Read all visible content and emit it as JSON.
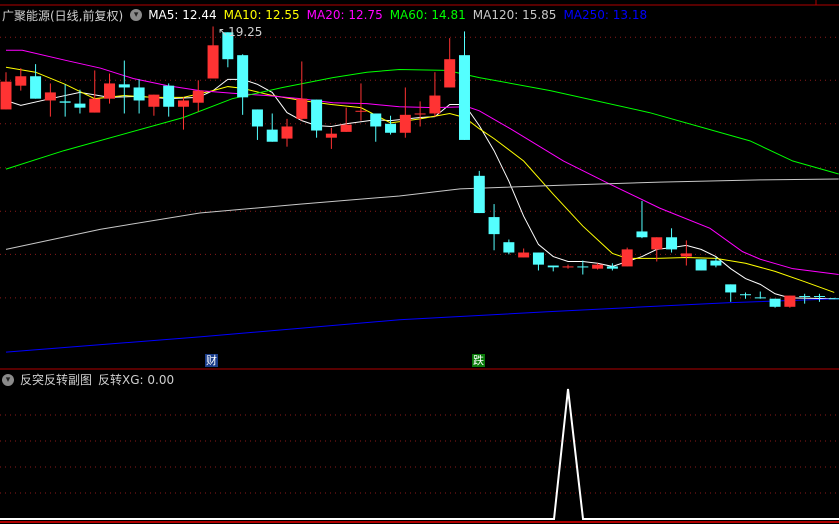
{
  "header": {
    "stock_name": "广聚能源(日线,前复权)",
    "ma": [
      {
        "label": "MA5: 12.44",
        "color": "#ffffff"
      },
      {
        "label": "MA10: 12.55",
        "color": "#ffff00"
      },
      {
        "label": "MA20: 12.75",
        "color": "#ff00ff"
      },
      {
        "label": "MA60: 14.81",
        "color": "#00ff00"
      },
      {
        "label": "MA120: 15.85",
        "color": "#c8c8c8"
      },
      {
        "label": "MA250: 13.18",
        "color": "#0000ff"
      }
    ],
    "high_marker": "19.25"
  },
  "markers": {
    "cai": "财",
    "die": "跌"
  },
  "sub_panel": {
    "title": "反突反转副图",
    "indicator": "反转XG: 0.00"
  },
  "colors": {
    "up": "#ff3333",
    "down": "#54ffff",
    "grid": "#8b1a1a",
    "border": "#b00000"
  },
  "chart_data": {
    "type": "candlestick",
    "candles": [
      [
        17.4,
        18.23,
        17.4,
        18.02
      ],
      [
        17.93,
        18.32,
        17.82,
        18.14
      ],
      [
        18.14,
        18.41,
        17.64,
        17.64
      ],
      [
        17.6,
        17.98,
        17.24,
        17.78
      ],
      [
        17.58,
        17.96,
        17.24,
        17.55
      ],
      [
        17.53,
        17.84,
        17.31,
        17.44
      ],
      [
        17.33,
        18.27,
        17.33,
        17.64
      ],
      [
        17.64,
        18.2,
        17.53,
        17.98
      ],
      [
        17.96,
        18.49,
        17.31,
        17.89
      ],
      [
        17.89,
        18.07,
        17.31,
        17.6
      ],
      [
        17.46,
        17.73,
        17.26,
        17.73
      ],
      [
        17.93,
        17.98,
        17.24,
        17.46
      ],
      [
        17.46,
        17.67,
        16.95,
        17.6
      ],
      [
        17.55,
        18.05,
        17.35,
        17.82
      ],
      [
        18.09,
        19.25,
        18.09,
        18.83
      ],
      [
        19.12,
        19.12,
        18.34,
        18.52
      ],
      [
        18.61,
        18.63,
        17.28,
        17.67
      ],
      [
        17.4,
        17.4,
        16.72,
        17.02
      ],
      [
        16.95,
        17.31,
        16.68,
        16.68
      ],
      [
        16.75,
        17.19,
        16.57,
        17.02
      ],
      [
        17.19,
        18.47,
        17.15,
        17.64
      ],
      [
        17.62,
        17.62,
        16.77,
        16.93
      ],
      [
        16.77,
        16.99,
        16.52,
        16.86
      ],
      [
        16.9,
        17.44,
        16.9,
        17.06
      ],
      [
        17.36,
        17.98,
        17.15,
        17.37
      ],
      [
        17.31,
        17.31,
        16.68,
        17.02
      ],
      [
        17.08,
        17.26,
        16.84,
        16.88
      ],
      [
        16.88,
        17.89,
        16.77,
        17.28
      ],
      [
        17.3,
        17.58,
        17.02,
        17.31
      ],
      [
        17.31,
        18.23,
        17.24,
        17.71
      ],
      [
        17.89,
        18.99,
        17.89,
        18.52
      ],
      [
        18.61,
        19.14,
        16.72,
        16.72
      ],
      [
        15.92,
        16.03,
        15.09,
        15.09
      ],
      [
        15.0,
        15.29,
        14.26,
        14.62
      ],
      [
        14.44,
        14.5,
        14.17,
        14.21
      ],
      [
        14.1,
        14.3,
        14.1,
        14.21
      ],
      [
        14.21,
        14.21,
        13.81,
        13.94
      ],
      [
        13.92,
        13.92,
        13.79,
        13.88
      ],
      [
        13.89,
        13.94,
        13.85,
        13.9
      ],
      [
        13.9,
        14.03,
        13.72,
        13.89
      ],
      [
        13.85,
        13.97,
        13.83,
        13.94
      ],
      [
        13.9,
        13.97,
        13.81,
        13.85
      ],
      [
        13.9,
        14.32,
        13.9,
        14.28
      ],
      [
        14.68,
        15.36,
        14.53,
        14.55
      ],
      [
        14.28,
        14.55,
        14.01,
        14.55
      ],
      [
        14.55,
        14.75,
        14.21,
        14.28
      ],
      [
        14.12,
        14.48,
        13.92,
        14.19
      ],
      [
        14.06,
        14.06,
        13.81,
        13.81
      ],
      [
        14.03,
        14.1,
        13.88,
        13.92
      ],
      [
        13.5,
        13.5,
        13.11,
        13.32
      ],
      [
        13.28,
        13.32,
        13.18,
        13.27
      ],
      [
        13.21,
        13.34,
        13.18,
        13.2
      ],
      [
        13.18,
        13.18,
        12.98,
        13.0
      ],
      [
        13.0,
        13.25,
        12.98,
        13.25
      ],
      [
        13.24,
        13.29,
        13.07,
        13.23
      ],
      [
        13.24,
        13.29,
        13.11,
        13.23
      ],
      [
        13.19,
        13.2,
        13.17,
        13.18
      ]
    ],
    "price_range": [
      11.68,
      19.84
    ],
    "grid_prices": [
      19.01,
      18.05,
      17.08,
      16.1,
      15.13,
      14.17,
      13.2
    ],
    "ma_lines": [
      {
        "name": "MA5",
        "color": "#ffffff",
        "points": [
          [
            1,
            17.6
          ],
          [
            2,
            17.49
          ],
          [
            4,
            17.64
          ],
          [
            6,
            17.78
          ],
          [
            8,
            17.67
          ],
          [
            10,
            17.69
          ],
          [
            12,
            17.64
          ],
          [
            14,
            17.67
          ],
          [
            15,
            17.82
          ],
          [
            16,
            18.07
          ],
          [
            17,
            18.07
          ],
          [
            18,
            17.96
          ],
          [
            19,
            17.78
          ],
          [
            20,
            17.33
          ],
          [
            21,
            17.15
          ],
          [
            22,
            17.04
          ],
          [
            23,
            17.02
          ],
          [
            24,
            17.08
          ],
          [
            26,
            17.17
          ],
          [
            27,
            17.15
          ],
          [
            29,
            17.22
          ],
          [
            30,
            17.24
          ],
          [
            31,
            17.51
          ],
          [
            32,
            17.51
          ],
          [
            33,
            17.04
          ],
          [
            34,
            16.48
          ],
          [
            35,
            15.8
          ],
          [
            36,
            15.02
          ],
          [
            37,
            14.39
          ],
          [
            38,
            14.12
          ],
          [
            39,
            14.01
          ],
          [
            40,
            14.01
          ],
          [
            41,
            13.97
          ],
          [
            42,
            13.9
          ],
          [
            43,
            14.01
          ],
          [
            44,
            14.12
          ],
          [
            45,
            14.28
          ],
          [
            46,
            14.32
          ],
          [
            47,
            14.37
          ],
          [
            48,
            14.28
          ],
          [
            49,
            14.12
          ],
          [
            50,
            13.85
          ],
          [
            51,
            13.63
          ],
          [
            52,
            13.5
          ],
          [
            53,
            13.29
          ],
          [
            54,
            13.2
          ],
          [
            57,
            13.18
          ]
        ]
      },
      {
        "name": "MA10",
        "color": "#ffff00",
        "points": [
          [
            1,
            18.34
          ],
          [
            3,
            18.23
          ],
          [
            5,
            17.96
          ],
          [
            7,
            17.64
          ],
          [
            9,
            17.71
          ],
          [
            11,
            17.67
          ],
          [
            13,
            17.67
          ],
          [
            15,
            17.82
          ],
          [
            16,
            17.91
          ],
          [
            17,
            17.87
          ],
          [
            19,
            17.71
          ],
          [
            21,
            17.6
          ],
          [
            23,
            17.51
          ],
          [
            25,
            17.44
          ],
          [
            27,
            17.1
          ],
          [
            29,
            17.19
          ],
          [
            31,
            17.31
          ],
          [
            32,
            17.22
          ],
          [
            33,
            16.97
          ],
          [
            34,
            16.75
          ],
          [
            36,
            16.25
          ],
          [
            38,
            15.51
          ],
          [
            40,
            14.8
          ],
          [
            42,
            14.19
          ],
          [
            43,
            14.08
          ],
          [
            45,
            14.08
          ],
          [
            47,
            14.1
          ],
          [
            49,
            14.08
          ],
          [
            51,
            13.97
          ],
          [
            53,
            13.79
          ],
          [
            55,
            13.56
          ],
          [
            57,
            13.32
          ]
        ]
      },
      {
        "name": "MA20",
        "color": "#ff00ff",
        "points": [
          [
            1,
            18.72
          ],
          [
            2.1,
            18.72
          ],
          [
            5.1,
            18.49
          ],
          [
            7.4,
            18.32
          ],
          [
            9.6,
            18.09
          ],
          [
            11.9,
            17.93
          ],
          [
            14.1,
            17.82
          ],
          [
            16.3,
            17.76
          ],
          [
            18.6,
            17.71
          ],
          [
            20.9,
            17.64
          ],
          [
            23.1,
            17.55
          ],
          [
            25.4,
            17.53
          ],
          [
            27.6,
            17.46
          ],
          [
            29.9,
            17.44
          ],
          [
            32.2,
            17.46
          ],
          [
            33,
            17.37
          ],
          [
            35.1,
            16.97
          ],
          [
            38.7,
            16.25
          ],
          [
            41.8,
            15.74
          ],
          [
            45.2,
            15.2
          ],
          [
            48.6,
            14.75
          ],
          [
            50.8,
            14.23
          ],
          [
            52,
            14.06
          ],
          [
            54.2,
            13.85
          ],
          [
            57.3,
            13.72
          ]
        ]
      },
      {
        "name": "MA60",
        "color": "#00ff00",
        "points": [
          [
            1,
            16.07
          ],
          [
            4.9,
            16.48
          ],
          [
            13,
            17.22
          ],
          [
            16.3,
            17.64
          ],
          [
            19.7,
            17.89
          ],
          [
            23.1,
            18.11
          ],
          [
            25.4,
            18.23
          ],
          [
            27.6,
            18.29
          ],
          [
            30.8,
            18.27
          ],
          [
            33,
            18.11
          ],
          [
            37.8,
            17.82
          ],
          [
            44.5,
            17.33
          ],
          [
            51.3,
            16.7
          ],
          [
            54.2,
            16.25
          ],
          [
            57.3,
            15.96
          ]
        ]
      },
      {
        "name": "MA120",
        "color": "#c8c8c8",
        "points": [
          [
            1,
            14.28
          ],
          [
            7.4,
            14.73
          ],
          [
            14.1,
            15.09
          ],
          [
            20.9,
            15.29
          ],
          [
            27.6,
            15.47
          ],
          [
            31.7,
            15.63
          ],
          [
            38.5,
            15.71
          ],
          [
            45.2,
            15.78
          ],
          [
            52,
            15.83
          ],
          [
            57.3,
            15.85
          ]
        ]
      },
      {
        "name": "MA250",
        "color": "#0000ff",
        "points": [
          [
            1,
            11.99
          ],
          [
            14.1,
            12.33
          ],
          [
            27.6,
            12.71
          ],
          [
            37.6,
            12.89
          ],
          [
            43,
            12.98
          ],
          [
            49.8,
            13.09
          ],
          [
            57.3,
            13.18
          ]
        ]
      }
    ],
    "sub_series": {
      "name": "反转XG",
      "spike_index": 39,
      "values_range": [
        0,
        1
      ]
    }
  }
}
